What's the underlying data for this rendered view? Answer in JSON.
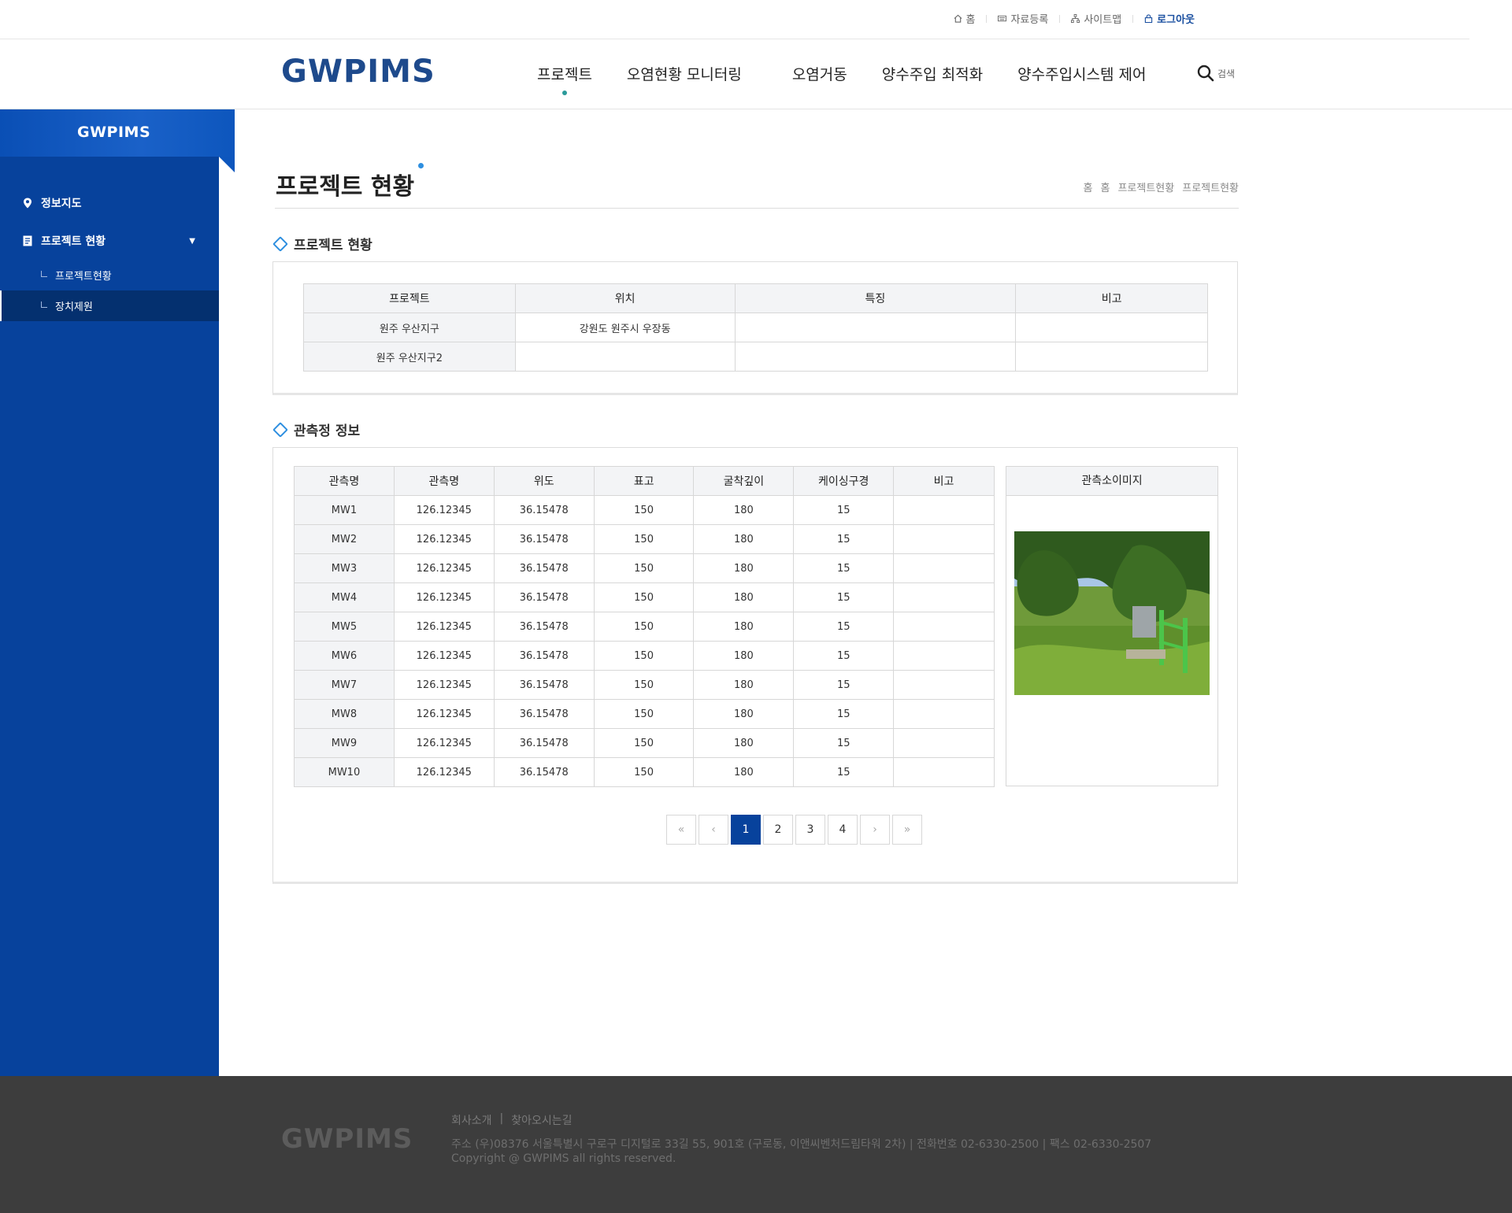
{
  "util": {
    "home": "홈",
    "register": "자료등록",
    "sitemap": "사이트맵",
    "logout": "로그아웃"
  },
  "header": {
    "logo": "GWPIMS",
    "nav": [
      "프로젝트",
      "오염현황 모니터링",
      "오염거동",
      "양수주입 최적화",
      "양수주입시스템 제어"
    ],
    "search": "검색"
  },
  "sidebar": {
    "logo": "GWPIMS",
    "items": [
      {
        "label": "정보지도"
      },
      {
        "label": "프로젝트 현황"
      }
    ],
    "subs": [
      "프로젝트현황",
      "장치제원"
    ]
  },
  "page": {
    "title": "프로젝트 현황",
    "breadcrumb": [
      "홈",
      "홈",
      "프로젝트현황",
      "프로젝트현황"
    ]
  },
  "project_section": {
    "title": "프로젝트 현황",
    "headers": [
      "프로젝트",
      "위치",
      "특징",
      "비고"
    ],
    "rows": [
      [
        "원주 우산지구",
        "강원도 원주시 우장동",
        "",
        ""
      ],
      [
        "원주 우산지구2",
        "",
        "",
        ""
      ]
    ]
  },
  "obs_section": {
    "title": "관측정 정보",
    "headers": [
      "관측명",
      "관측명",
      "위도",
      "표고",
      "굴착깊이",
      "케이싱구경",
      "비고"
    ],
    "rows": [
      [
        "MW1",
        "126.12345",
        "36.15478",
        "150",
        "180",
        "15",
        ""
      ],
      [
        "MW2",
        "126.12345",
        "36.15478",
        "150",
        "180",
        "15",
        ""
      ],
      [
        "MW3",
        "126.12345",
        "36.15478",
        "150",
        "180",
        "15",
        ""
      ],
      [
        "MW4",
        "126.12345",
        "36.15478",
        "150",
        "180",
        "15",
        ""
      ],
      [
        "MW5",
        "126.12345",
        "36.15478",
        "150",
        "180",
        "15",
        ""
      ],
      [
        "MW6",
        "126.12345",
        "36.15478",
        "150",
        "180",
        "15",
        ""
      ],
      [
        "MW7",
        "126.12345",
        "36.15478",
        "150",
        "180",
        "15",
        ""
      ],
      [
        "MW8",
        "126.12345",
        "36.15478",
        "150",
        "180",
        "15",
        ""
      ],
      [
        "MW9",
        "126.12345",
        "36.15478",
        "150",
        "180",
        "15",
        ""
      ],
      [
        "MW10",
        "126.12345",
        "36.15478",
        "150",
        "180",
        "15",
        ""
      ]
    ],
    "image_header": "관측소이미지"
  },
  "pager": {
    "first": "«",
    "prev": "‹",
    "pages": [
      "1",
      "2",
      "3",
      "4"
    ],
    "next": "›",
    "last": "»",
    "current": "1"
  },
  "footer": {
    "logo": "GWPIMS",
    "link_company": "회사소개",
    "link_divider": "|",
    "link_directions": "찾아오시는길",
    "address": "주소 (우)08376 서울특별시 구로구 디지털로 33길 55, 901호 (구로동, 이앤씨벤처드림타워 2차)  |  전화번호 02-6330-2500  |  팩스 02-6330-2507",
    "copyright": "Copyright @ GWPIMS all rights reserved."
  },
  "colors": {
    "sidebar": "#07429c",
    "accent": "#2e8fe0",
    "footer": "#3d3d3d"
  }
}
